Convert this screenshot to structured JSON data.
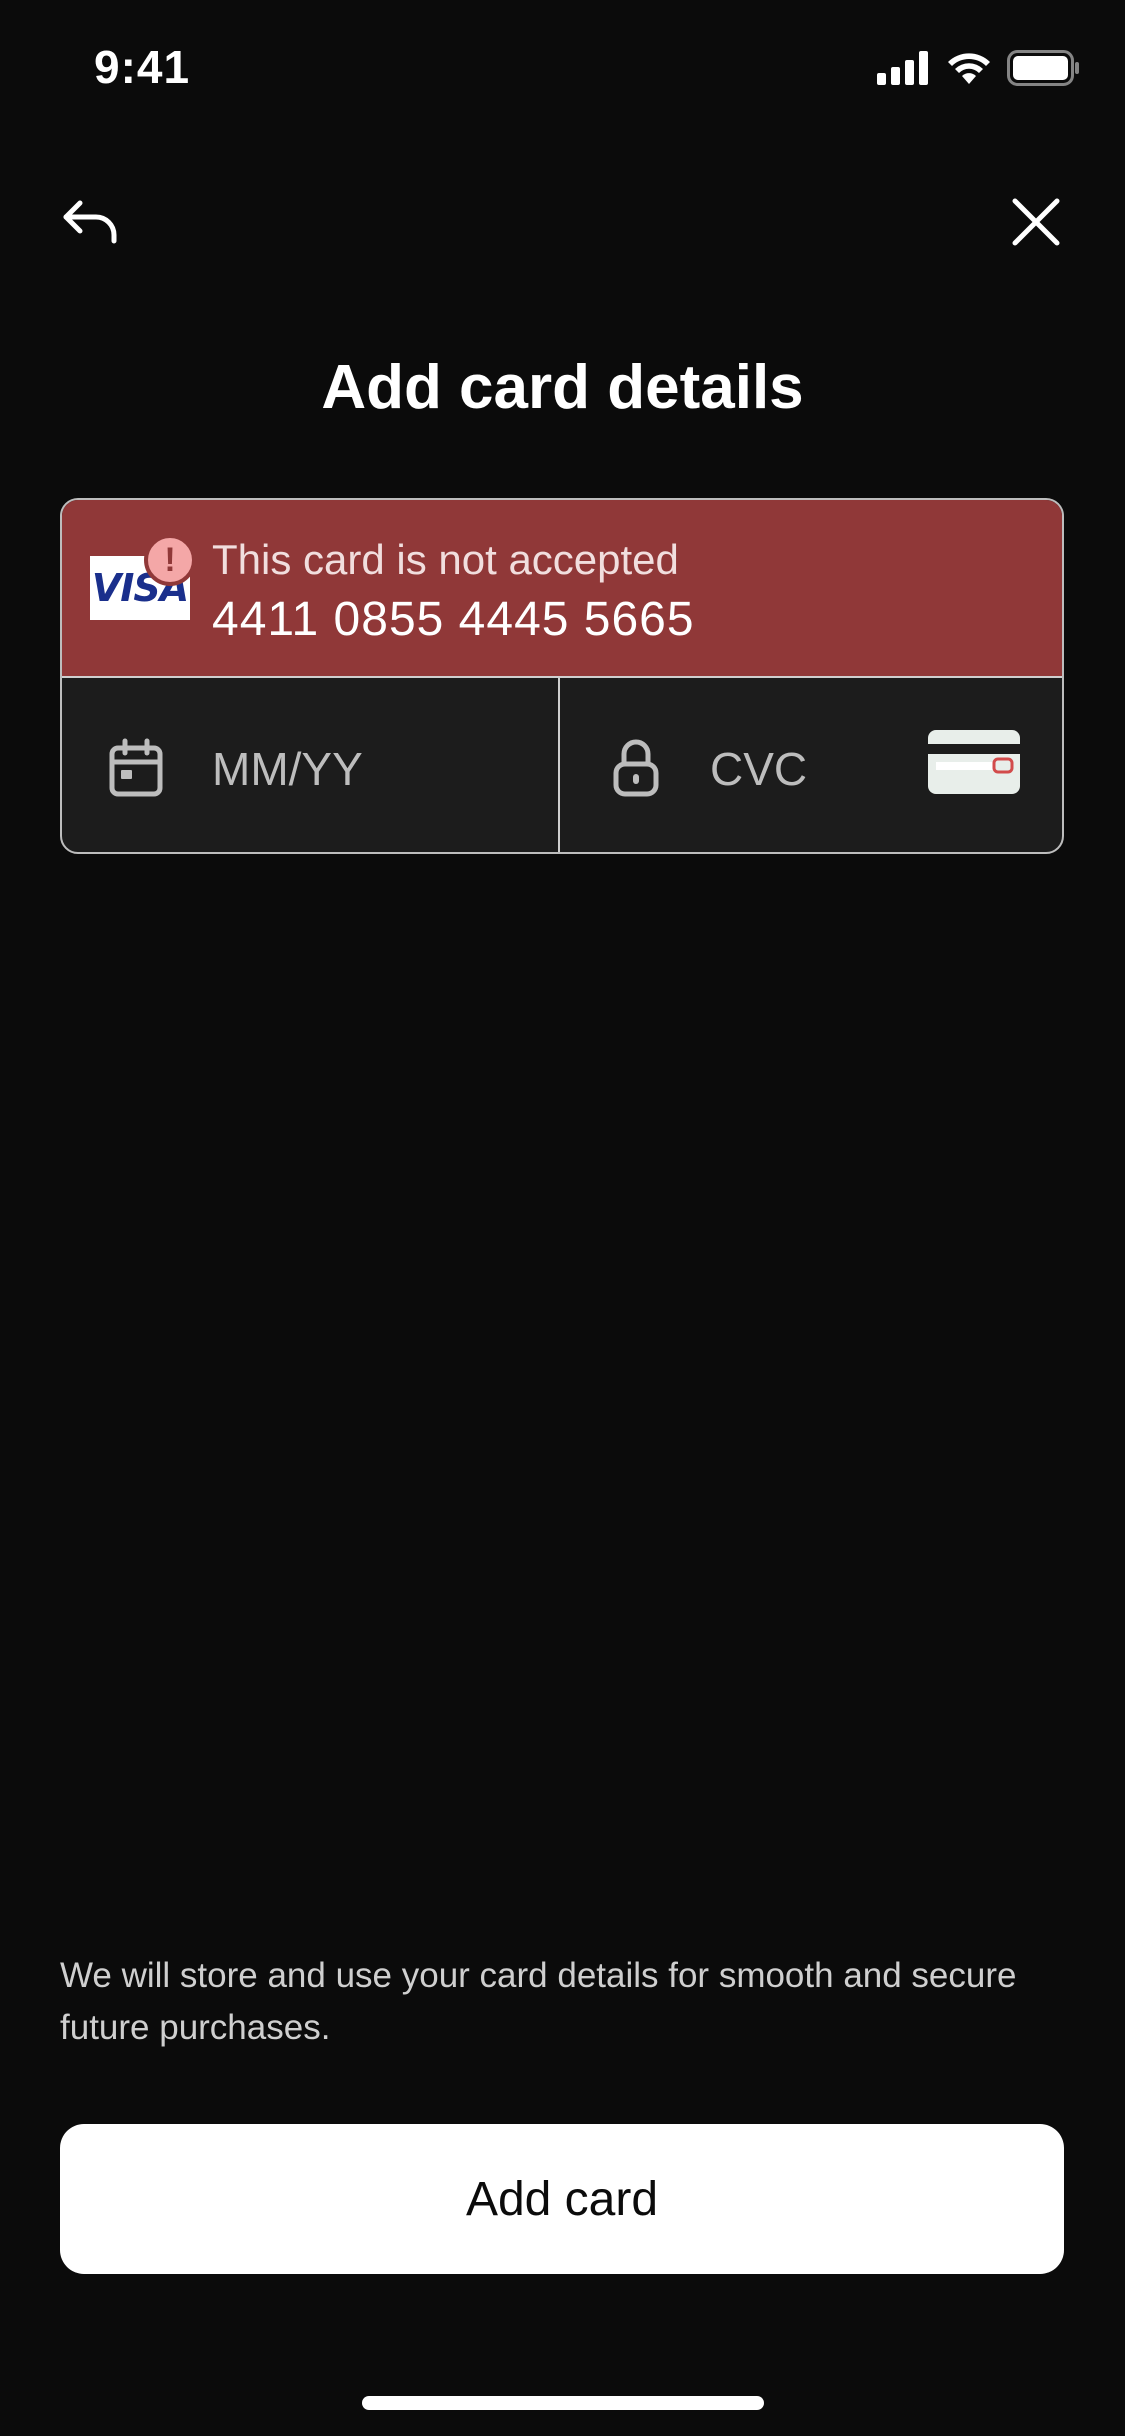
{
  "status_bar": {
    "time": "9:41",
    "icons": [
      "cellular-signal-icon",
      "wifi-icon",
      "battery-icon"
    ]
  },
  "nav": {
    "back_icon": "back-arrow-icon",
    "close_icon": "close-icon"
  },
  "page": {
    "title": "Add card details"
  },
  "card_form": {
    "brand": "VISA",
    "error_message": "This card is not accepted",
    "card_number": "4411 0855 4445 5665",
    "expiry_placeholder": "MM/YY",
    "cvc_placeholder": "CVC"
  },
  "footer": {
    "storage_note": "We will store and use your card details for smooth and secure future purchases.",
    "add_card_label": "Add card"
  },
  "colors": {
    "background": "#0b0b0b",
    "error_row": "#903838",
    "field_bg": "#1c1c1c",
    "button_bg": "#ffffff",
    "visa_blue": "#1a2f8c"
  }
}
